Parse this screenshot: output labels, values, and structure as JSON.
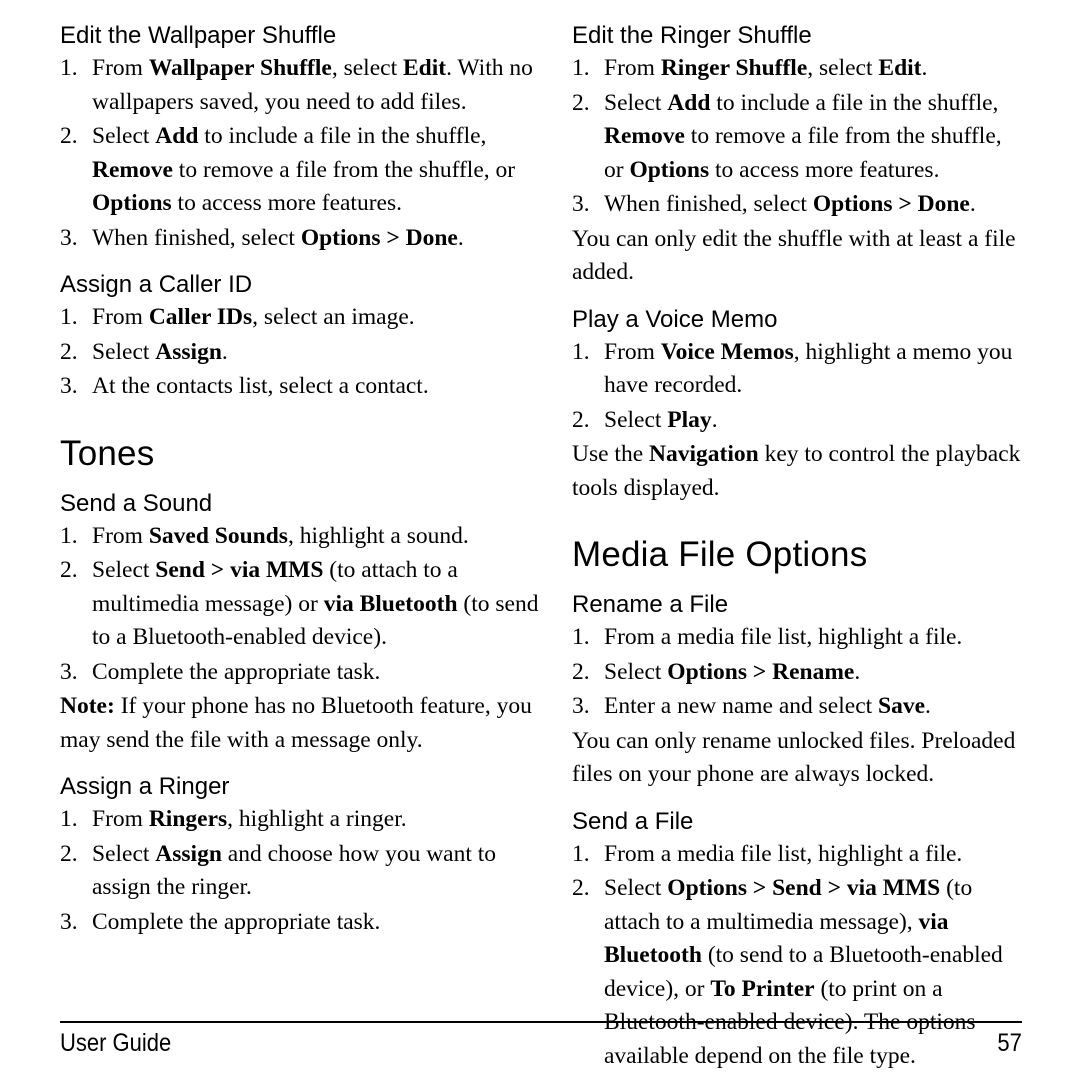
{
  "page": {
    "number": "57",
    "footer_label": "User Guide"
  },
  "left_column": {
    "blocks": [
      {
        "type": "section",
        "heading": "Edit the Wallpaper Shuffle",
        "steps": [
          {
            "num": "1.",
            "parts": [
              {
                "t": "From ",
                "b": false
              },
              {
                "t": "Wallpaper Shuffle",
                "b": true
              },
              {
                "t": ", select ",
                "b": false
              },
              {
                "t": "Edit",
                "b": true
              },
              {
                "t": ". With no wallpapers saved, you need to add files.",
                "b": false
              }
            ]
          },
          {
            "num": "2.",
            "parts": [
              {
                "t": "Select ",
                "b": false
              },
              {
                "t": "Add",
                "b": true
              },
              {
                "t": " to include a file in the shuffle, ",
                "b": false
              },
              {
                "t": "Remove",
                "b": true
              },
              {
                "t": " to remove a file from the shuffle, or ",
                "b": false
              },
              {
                "t": "Options",
                "b": true
              },
              {
                "t": " to access more features.",
                "b": false
              }
            ]
          },
          {
            "num": "3.",
            "parts": [
              {
                "t": "When finished, select ",
                "b": false
              },
              {
                "t": "Options > Done",
                "b": true
              },
              {
                "t": ".",
                "b": false
              }
            ]
          }
        ]
      },
      {
        "type": "section",
        "heading": "Assign a Caller ID",
        "steps": [
          {
            "num": "1.",
            "parts": [
              {
                "t": "From ",
                "b": false
              },
              {
                "t": "Caller IDs",
                "b": true
              },
              {
                "t": ", select an image.",
                "b": false
              }
            ]
          },
          {
            "num": "2.",
            "parts": [
              {
                "t": "Select ",
                "b": false
              },
              {
                "t": "Assign",
                "b": true
              },
              {
                "t": ".",
                "b": false
              }
            ]
          },
          {
            "num": "3.",
            "parts": [
              {
                "t": "At the contacts list, select a contact.",
                "b": false
              }
            ]
          }
        ]
      },
      {
        "type": "chapter",
        "heading": "Tones"
      },
      {
        "type": "section",
        "heading": "Send a Sound",
        "steps": [
          {
            "num": "1.",
            "parts": [
              {
                "t": "From ",
                "b": false
              },
              {
                "t": "Saved Sounds",
                "b": true
              },
              {
                "t": ", highlight a sound.",
                "b": false
              }
            ]
          },
          {
            "num": "2.",
            "parts": [
              {
                "t": "Select ",
                "b": false
              },
              {
                "t": "Send > via MMS",
                "b": true
              },
              {
                "t": " (to attach to a multimedia message) or ",
                "b": false
              },
              {
                "t": "via Bluetooth",
                "b": true
              },
              {
                "t": " (to send to a Bluetooth-enabled device).",
                "b": false
              }
            ]
          },
          {
            "num": "3.",
            "parts": [
              {
                "t": "Complete the appropriate task.",
                "b": false
              }
            ]
          }
        ],
        "note": [
          {
            "t": "Note:",
            "b": true
          },
          {
            "t": " If your phone has no Bluetooth feature, you may send the file with a message only.",
            "b": false
          }
        ]
      },
      {
        "type": "section",
        "heading": "Assign a Ringer",
        "steps": [
          {
            "num": "1.",
            "parts": [
              {
                "t": "From ",
                "b": false
              },
              {
                "t": "Ringers",
                "b": true
              },
              {
                "t": ", highlight a ringer.",
                "b": false
              }
            ]
          },
          {
            "num": "2.",
            "parts": [
              {
                "t": "Select ",
                "b": false
              },
              {
                "t": "Assign",
                "b": true
              },
              {
                "t": " and choose how you want to assign the ringer.",
                "b": false
              }
            ]
          },
          {
            "num": "3.",
            "parts": [
              {
                "t": "Complete the appropriate task.",
                "b": false
              }
            ]
          }
        ]
      }
    ]
  },
  "right_column": {
    "blocks": [
      {
        "type": "section",
        "heading": "Edit the Ringer Shuffle",
        "steps": [
          {
            "num": "1.",
            "parts": [
              {
                "t": "From ",
                "b": false
              },
              {
                "t": "Ringer Shuffle",
                "b": true
              },
              {
                "t": ", select ",
                "b": false
              },
              {
                "t": "Edit",
                "b": true
              },
              {
                "t": ".",
                "b": false
              }
            ]
          },
          {
            "num": "2.",
            "parts": [
              {
                "t": "Select ",
                "b": false
              },
              {
                "t": "Add",
                "b": true
              },
              {
                "t": " to include a file in the shuffle, ",
                "b": false
              },
              {
                "t": "Remove",
                "b": true
              },
              {
                "t": " to remove a file from the shuffle, or ",
                "b": false
              },
              {
                "t": "Options",
                "b": true
              },
              {
                "t": " to access more features.",
                "b": false
              }
            ]
          },
          {
            "num": "3.",
            "parts": [
              {
                "t": "When finished, select ",
                "b": false
              },
              {
                "t": "Options > Done",
                "b": true
              },
              {
                "t": ".",
                "b": false
              }
            ]
          }
        ],
        "note": [
          {
            "t": "You can only edit the shuffle with at least a file added.",
            "b": false
          }
        ]
      },
      {
        "type": "section",
        "heading": "Play a Voice Memo",
        "steps": [
          {
            "num": "1.",
            "parts": [
              {
                "t": "From ",
                "b": false
              },
              {
                "t": "Voice Memos",
                "b": true
              },
              {
                "t": ", highlight a memo you have recorded.",
                "b": false
              }
            ]
          },
          {
            "num": "2.",
            "parts": [
              {
                "t": "Select ",
                "b": false
              },
              {
                "t": "Play",
                "b": true
              },
              {
                "t": ".",
                "b": false
              }
            ]
          }
        ],
        "note": [
          {
            "t": "Use the ",
            "b": false
          },
          {
            "t": "Navigation",
            "b": true
          },
          {
            "t": " key to control the playback tools displayed.",
            "b": false
          }
        ]
      },
      {
        "type": "chapter",
        "heading": "Media File Options"
      },
      {
        "type": "section",
        "heading": "Rename a File",
        "steps": [
          {
            "num": "1.",
            "parts": [
              {
                "t": "From a media file list, highlight a file.",
                "b": false
              }
            ]
          },
          {
            "num": "2.",
            "parts": [
              {
                "t": "Select ",
                "b": false
              },
              {
                "t": "Options > Rename",
                "b": true
              },
              {
                "t": ".",
                "b": false
              }
            ]
          },
          {
            "num": "3.",
            "parts": [
              {
                "t": "Enter a new name and select ",
                "b": false
              },
              {
                "t": "Save",
                "b": true
              },
              {
                "t": ".",
                "b": false
              }
            ]
          }
        ],
        "note": [
          {
            "t": "You can only rename unlocked files. Preloaded files on your phone are always locked.",
            "b": false
          }
        ]
      },
      {
        "type": "section",
        "heading": "Send a File",
        "steps": [
          {
            "num": "1.",
            "parts": [
              {
                "t": "From a media file list, highlight a file.",
                "b": false
              }
            ]
          },
          {
            "num": "2.",
            "parts": [
              {
                "t": "Select ",
                "b": false
              },
              {
                "t": "Options > Send > via MMS",
                "b": true
              },
              {
                "t": " (to attach to a multimedia message), ",
                "b": false
              },
              {
                "t": "via Bluetooth",
                "b": true
              },
              {
                "t": " (to send to a Bluetooth-enabled device), or ",
                "b": false
              },
              {
                "t": "To Printer",
                "b": true
              },
              {
                "t": " (to print on a Bluetooth-enabled device). The options available depend on the file type.",
                "b": false
              }
            ]
          }
        ]
      }
    ]
  }
}
